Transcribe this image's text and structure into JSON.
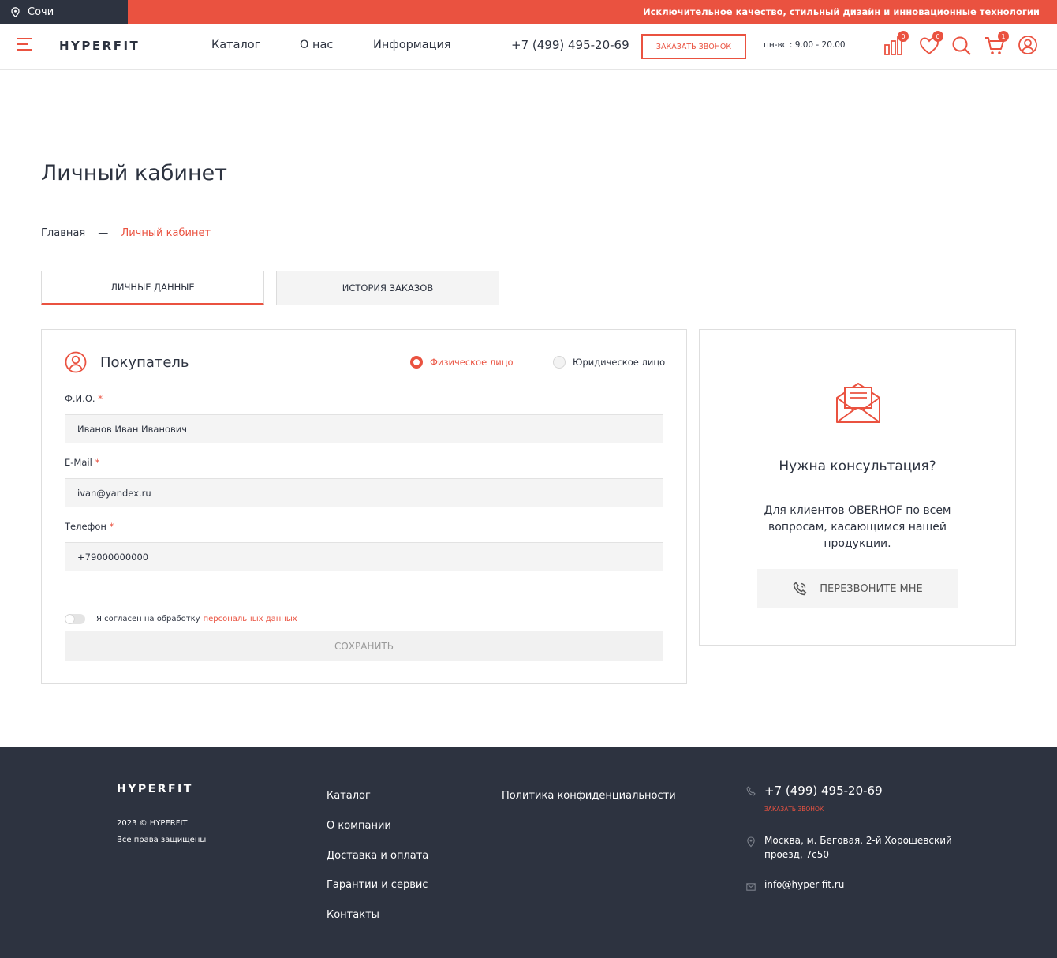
{
  "topbar": {
    "city": "Сочи",
    "slogan": "Исключительное качество, стильный дизайн и инновационные технологии"
  },
  "header": {
    "logo": "HYPERFIT",
    "nav": [
      "Каталог",
      "О нас",
      "Информация"
    ],
    "phone": "+7 (499) 495-20-69",
    "callback_label": "ЗАКАЗАТЬ ЗВОНОК",
    "hours": "пн-вс : 9.00 - 20.00",
    "badges": {
      "compare": "0",
      "favorites": "0",
      "cart": "1"
    }
  },
  "page": {
    "title": "Личный кабинет",
    "breadcrumb": {
      "home": "Главная",
      "separator": "—",
      "current": "Личный кабинет"
    },
    "tabs": [
      {
        "label": "ЛИЧНЫЕ ДАННЫЕ",
        "active": true
      },
      {
        "label": "ИСТОРИЯ ЗАКАЗОВ",
        "active": false
      }
    ]
  },
  "form": {
    "title": "Покупатель",
    "person_type": {
      "individual": "Физическое лицо",
      "legal": "Юридическое лицо",
      "selected": "individual"
    },
    "fields": {
      "name": {
        "label": "Ф.И.О.",
        "value": "Иванов Иван Иванович"
      },
      "email": {
        "label": "E-Mail",
        "value": "ivan@yandex.ru"
      },
      "phone": {
        "label": "Телефон",
        "value": "+79000000000"
      }
    },
    "required_mark": "*",
    "consent_text": "Я согласен на обработку",
    "consent_link": "персональных данных",
    "save_label": "СОХРАНИТЬ"
  },
  "consult": {
    "title": "Нужна консультация?",
    "text": "Для клиентов OBERHOF по всем вопросам, касающимся нашей продукции.",
    "button": "ПЕРЕЗВОНИТЕ МНЕ"
  },
  "footer": {
    "logo": "HYPERFIT",
    "copyright": "2023 © HYPERFIT",
    "rights": "Все права защищены",
    "links": [
      "Каталог",
      "О компании",
      "Доставка и оплата",
      "Гарантии и сервис",
      "Контакты"
    ],
    "policy": "Политика конфиденциальности",
    "phone": "+7 (499) 495-20-69",
    "callback": "ЗАКАЗАТЬ ЗВОНОК",
    "address": "Москва, м. Беговая, 2-й Хорошевский проезд, 7с50",
    "email": "info@hyper-fit.ru"
  },
  "colors": {
    "accent": "#ea5240",
    "dark": "#2d3340"
  }
}
